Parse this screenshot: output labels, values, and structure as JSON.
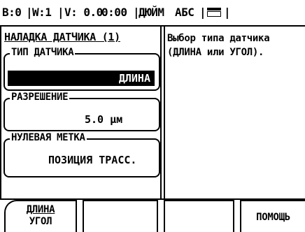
{
  "status": {
    "axis": "B:0",
    "tool": "W:1",
    "feed": "V: 0.0",
    "time": "0:00",
    "units": "ДЮЙМ",
    "mode": "АБС"
  },
  "panel": {
    "title": "НАЛАДКА ДАТЧИКА (1)",
    "sensor_type_label": "ТИП ДАТЧИКА",
    "sensor_type_value": "ДЛИНА",
    "resolution_label": "РАЗРЕШЕНИЕ",
    "resolution_value": "5.0 μм",
    "ref_mark_label": "НУЛЕВАЯ МЕТКА",
    "ref_mark_value": "ПОЗИЦИЯ ТРАСС."
  },
  "help": {
    "line1": "Выбор типа датчика",
    "line2": "(ДЛИНА или УГОЛ)."
  },
  "softkeys": {
    "key1_line1": "ДЛИНА",
    "key1_line2": "УГОЛ",
    "key2": "",
    "key3": "",
    "key4": "ПОМОЩЬ"
  },
  "icons": {
    "keyboard": "keyboard-icon"
  }
}
